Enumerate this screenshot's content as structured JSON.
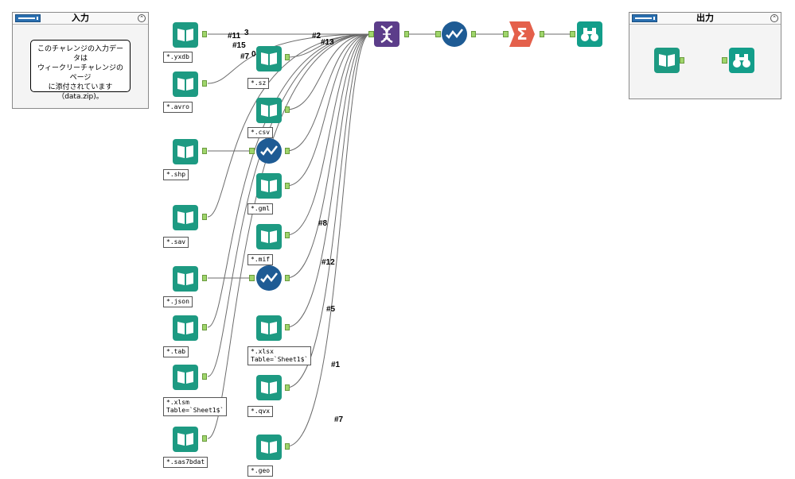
{
  "containers": {
    "input": {
      "title": "入力",
      "comment": "このチャレンジの入力データは\nウィークリーチャレンジのページ\nに添付されています\n（data.zip)。"
    },
    "output": {
      "title": "出力"
    }
  },
  "annotations": {
    "yxdb": "*.yxdb",
    "avro": "*.avro",
    "shp": "*.shp",
    "sav": "*.sav",
    "json": "*.json",
    "tab": "*.tab",
    "xlsm": "*.xlsm\nTable=`Sheet1$`",
    "sas7bdat": "*.sas7bdat",
    "sz": "*.sz",
    "csv": "*.csv",
    "gml": "*.gml",
    "mif": "*.mif",
    "xlsx": "*.xlsx\nTable=`Sheet1$`",
    "qvx": "*.qvx",
    "geo": "*.geo"
  },
  "wire_labels": {
    "l11": "#11",
    "l3": "3",
    "l15": "#15",
    "l0": "0",
    "l7top": "#7",
    "l2": "#2",
    "l13": "#13",
    "l8": "#8",
    "l12": "#12",
    "l5": "#5",
    "l1": "#1",
    "l7": "#7"
  },
  "tools": {
    "union_icon": "union-icon",
    "summarize_symbol": "Σ",
    "browse_icon": "binoculars-icon",
    "input_icon": "book-icon",
    "select_icon": "checkmark-icon"
  },
  "colors": {
    "input_tool": "#1d9a82",
    "select_tool": "#1e5b94",
    "union_tool": "#5c3d8a",
    "summarize_tool": "#e4604b",
    "browse_tool": "#139e8a",
    "anchor": "#9fd56b"
  }
}
